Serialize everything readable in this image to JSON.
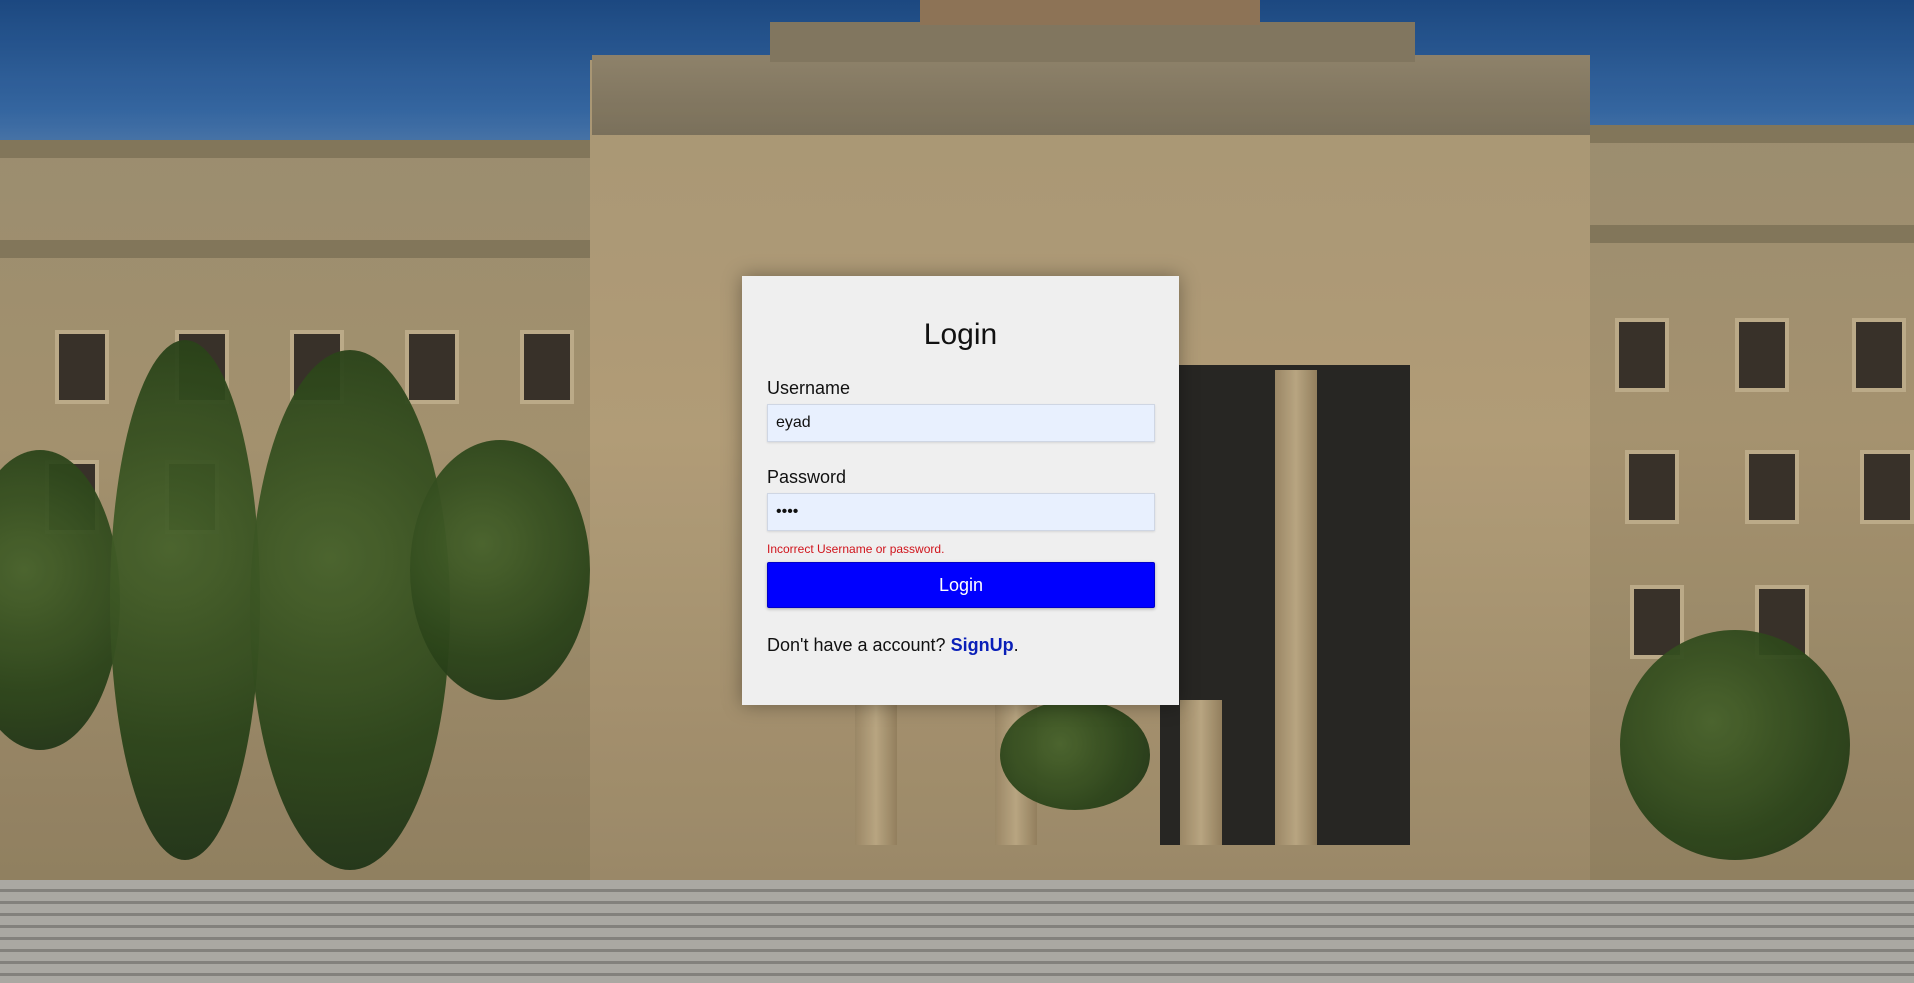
{
  "login": {
    "title": "Login",
    "username_label": "Username",
    "username_value": "eyad",
    "password_label": "Password",
    "password_value": "••••",
    "error_message": "Incorrect Username or password.",
    "button_label": "Login",
    "signup_prompt": "Don't have a account?",
    "signup_link": "SignUp",
    "signup_suffix": "."
  },
  "colors": {
    "button_bg": "#0000ff",
    "error": "#d0141c",
    "link": "#0a1fb8",
    "card_bg": "#efefef",
    "input_bg": "#e8f0fe"
  }
}
